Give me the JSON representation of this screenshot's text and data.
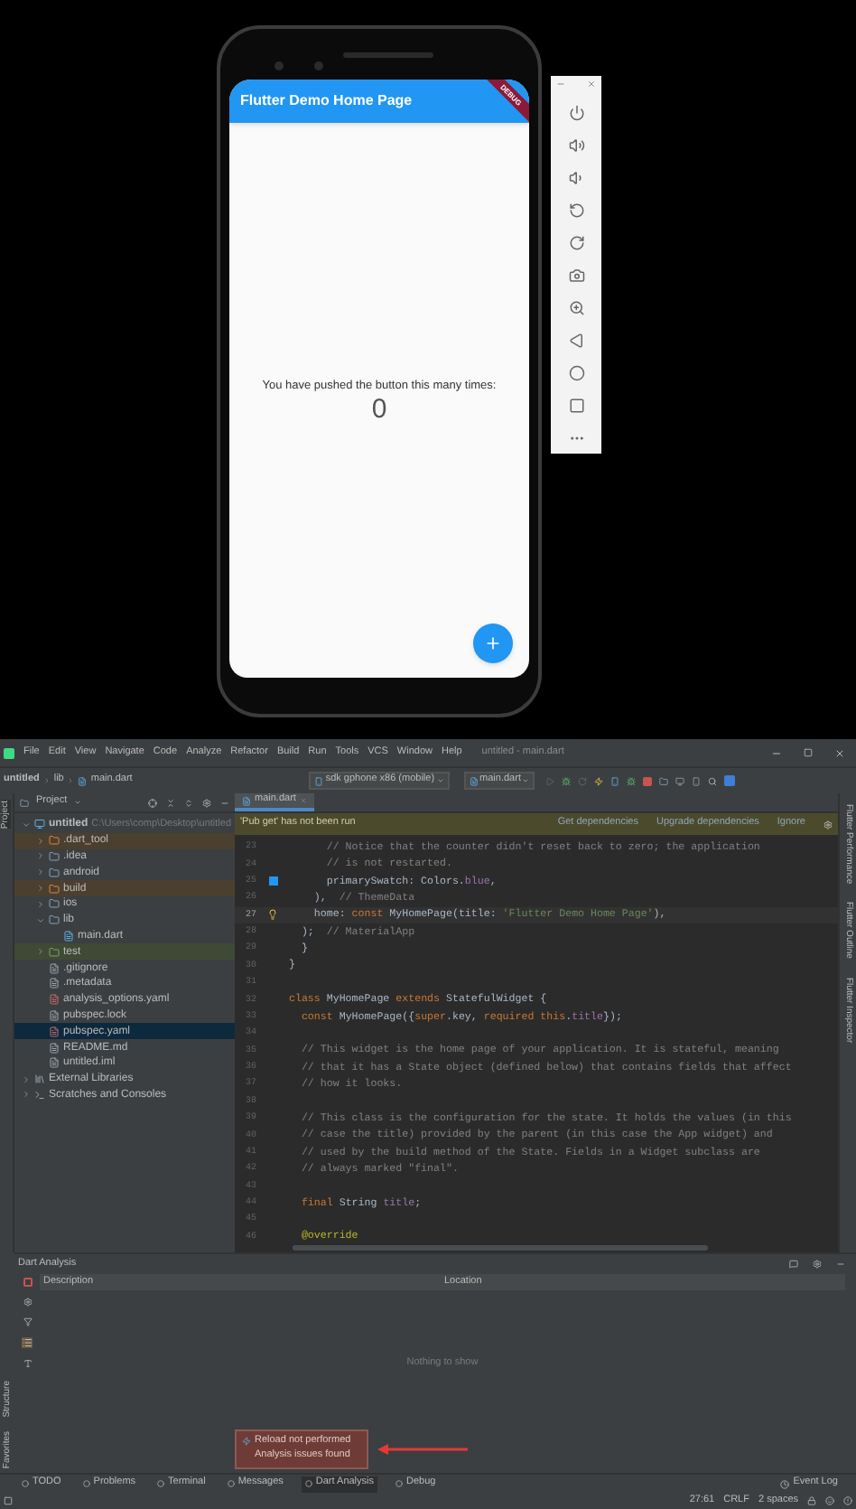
{
  "emulator": {
    "app_title": "Flutter Demo Home Page",
    "debug_banner": "DEBUG",
    "counter_label": "You have pushed the button this many times:",
    "counter_value": "0"
  },
  "menu": [
    "File",
    "Edit",
    "View",
    "Navigate",
    "Code",
    "Analyze",
    "Refactor",
    "Build",
    "Run",
    "Tools",
    "VCS",
    "Window",
    "Help"
  ],
  "window_title": "untitled - main.dart",
  "breadcrumb": [
    "untitled",
    "lib",
    "main.dart"
  ],
  "device_selector": "sdk gphone x86 (mobile)",
  "run_config": "main.dart",
  "left_strip": {
    "top": [
      "Project"
    ],
    "bottom": [
      "Structure",
      "Favorites"
    ]
  },
  "project_panel": {
    "title": "Project",
    "tree": [
      {
        "label": "untitled",
        "path": "C:\\Users\\comp\\Desktop\\untitled",
        "kind": "module",
        "expanded": true,
        "selected": false,
        "children": [
          {
            "label": ".dart_tool",
            "kind": "excluded",
            "expanded": false,
            "selected": false
          },
          {
            "label": ".idea",
            "kind": "folder",
            "expanded": false,
            "selected": false
          },
          {
            "label": "android",
            "kind": "folder",
            "expanded": false,
            "selected": false
          },
          {
            "label": "build",
            "kind": "excluded",
            "expanded": false,
            "selected": false
          },
          {
            "label": "ios",
            "kind": "folder",
            "expanded": false,
            "selected": false
          },
          {
            "label": "lib",
            "kind": "folder",
            "expanded": true,
            "selected": false,
            "children": [
              {
                "label": "main.dart",
                "kind": "dart",
                "selected": false
              }
            ]
          },
          {
            "label": "test",
            "kind": "testfolder",
            "expanded": false,
            "selected": false
          },
          {
            "label": ".gitignore",
            "kind": "file",
            "selected": false
          },
          {
            "label": ".metadata",
            "kind": "file",
            "selected": false
          },
          {
            "label": "analysis_options.yaml",
            "kind": "yaml",
            "selected": false
          },
          {
            "label": "pubspec.lock",
            "kind": "file",
            "selected": false
          },
          {
            "label": "pubspec.yaml",
            "kind": "yaml",
            "selected": true
          },
          {
            "label": "README.md",
            "kind": "file",
            "selected": false
          },
          {
            "label": "untitled.iml",
            "kind": "file",
            "selected": false
          }
        ]
      },
      {
        "label": "External Libraries",
        "kind": "library",
        "expanded": false,
        "selected": false
      },
      {
        "label": "Scratches and Consoles",
        "kind": "scratch",
        "expanded": false,
        "selected": false
      }
    ]
  },
  "editor_tabs": [
    {
      "label": "main.dart",
      "selected": true
    }
  ],
  "notification": {
    "message": "'Pub get' has not been run",
    "actions": [
      "Get dependencies",
      "Upgrade dependencies",
      "Ignore"
    ]
  },
  "code": [
    {
      "number": "23",
      "kind": "plain",
      "current": false,
      "segments": [
        {
          "kind": "comment",
          "text": "      // Notice that the counter didn't reset back to zero; the application"
        }
      ]
    },
    {
      "number": "24",
      "kind": "plain",
      "current": false,
      "segments": [
        {
          "kind": "comment",
          "text": "      // is not restarted."
        }
      ]
    },
    {
      "number": "25",
      "kind": "swatch",
      "current": false,
      "segments": [
        {
          "kind": "plain",
          "text": "      primarySwatch: Colors."
        },
        {
          "kind": "field",
          "text": "blue"
        },
        {
          "kind": "plain",
          "text": ","
        }
      ]
    },
    {
      "number": "26",
      "kind": "plain",
      "current": false,
      "segments": [
        {
          "kind": "plain",
          "text": "    ),  "
        },
        {
          "kind": "comment",
          "text": "// ThemeData"
        }
      ]
    },
    {
      "number": "27",
      "kind": "bulb",
      "current": true,
      "segments": [
        {
          "kind": "plain",
          "text": "    home: "
        },
        {
          "kind": "keyword",
          "text": "const "
        },
        {
          "kind": "plain",
          "text": "MyHomePage(title: "
        },
        {
          "kind": "string",
          "text": "'Flutter Demo Home Page'"
        },
        {
          "kind": "plain",
          "text": "),"
        }
      ]
    },
    {
      "number": "28",
      "kind": "plain",
      "current": false,
      "segments": [
        {
          "kind": "plain",
          "text": "  );  "
        },
        {
          "kind": "comment",
          "text": "// MaterialApp"
        }
      ]
    },
    {
      "number": "29",
      "kind": "plain",
      "current": false,
      "segments": [
        {
          "kind": "plain",
          "text": "  }"
        }
      ]
    },
    {
      "number": "30",
      "kind": "plain",
      "current": false,
      "segments": [
        {
          "kind": "plain",
          "text": "}"
        }
      ]
    },
    {
      "number": "31",
      "kind": "plain",
      "current": false
    },
    {
      "number": "32",
      "kind": "plain",
      "current": false,
      "segments": [
        {
          "kind": "keyword",
          "text": "class "
        },
        {
          "kind": "plain",
          "text": "MyHomePage "
        },
        {
          "kind": "keyword",
          "text": "extends "
        },
        {
          "kind": "plain",
          "text": "StatefulWidget {"
        }
      ]
    },
    {
      "number": "33",
      "kind": "plain",
      "current": false,
      "segments": [
        {
          "kind": "keyword",
          "text": "  const "
        },
        {
          "kind": "plain",
          "text": "MyHomePage({"
        },
        {
          "kind": "keyword",
          "text": "super"
        },
        {
          "kind": "plain",
          "text": ".key, "
        },
        {
          "kind": "keyword",
          "text": "required this"
        },
        {
          "kind": "plain",
          "text": "."
        },
        {
          "kind": "field",
          "text": "title"
        },
        {
          "kind": "plain",
          "text": "});"
        }
      ]
    },
    {
      "number": "34",
      "kind": "plain",
      "current": false
    },
    {
      "number": "35",
      "kind": "plain",
      "current": false,
      "segments": [
        {
          "kind": "comment",
          "text": "  // This widget is the home page of your application. It is stateful, meaning"
        }
      ]
    },
    {
      "number": "36",
      "kind": "plain",
      "current": false,
      "segments": [
        {
          "kind": "comment",
          "text": "  // that it has a State object (defined below) that contains fields that affect"
        }
      ]
    },
    {
      "number": "37",
      "kind": "plain",
      "current": false,
      "segments": [
        {
          "kind": "comment",
          "text": "  // how it looks."
        }
      ]
    },
    {
      "number": "38",
      "kind": "plain",
      "current": false
    },
    {
      "number": "39",
      "kind": "plain",
      "current": false,
      "segments": [
        {
          "kind": "comment",
          "text": "  // This class is the configuration for the state. It holds the values (in this"
        }
      ]
    },
    {
      "number": "40",
      "kind": "plain",
      "current": false,
      "segments": [
        {
          "kind": "comment",
          "text": "  // case the title) provided by the parent (in this case the App widget) and"
        }
      ]
    },
    {
      "number": "41",
      "kind": "plain",
      "current": false,
      "segments": [
        {
          "kind": "comment",
          "text": "  // used by the build method of the State. Fields in a Widget subclass are"
        }
      ]
    },
    {
      "number": "42",
      "kind": "plain",
      "current": false,
      "segments": [
        {
          "kind": "comment",
          "text": "  // always marked \"final\"."
        }
      ]
    },
    {
      "number": "43",
      "kind": "plain",
      "current": false
    },
    {
      "number": "44",
      "kind": "plain",
      "current": false,
      "segments": [
        {
          "kind": "keyword",
          "text": "  final "
        },
        {
          "kind": "plain",
          "text": "String "
        },
        {
          "kind": "field",
          "text": "title"
        },
        {
          "kind": "plain",
          "text": ";"
        }
      ]
    },
    {
      "number": "45",
      "kind": "plain",
      "current": false
    },
    {
      "number": "46",
      "kind": "plain",
      "current": false,
      "segments": [
        {
          "kind": "annotation",
          "text": "  @override"
        }
      ]
    }
  ],
  "right_strip": [
    "Flutter Performance",
    "Flutter Outline",
    "Flutter Inspector"
  ],
  "analysis": {
    "title": "Dart Analysis",
    "columns": [
      "Description",
      "Location"
    ],
    "empty_text": "Nothing to show"
  },
  "popup": {
    "lines": [
      "Reload not performed",
      "Analysis issues found"
    ]
  },
  "tool_windows": [
    {
      "label": "TODO",
      "selected": false
    },
    {
      "label": "Problems",
      "selected": false
    },
    {
      "label": "Terminal",
      "selected": false
    },
    {
      "label": "Messages",
      "selected": false
    },
    {
      "label": "Dart Analysis",
      "selected": true
    },
    {
      "label": "Debug",
      "selected": false
    }
  ],
  "event_log": "Event Log",
  "status": [
    "27:61",
    "CRLF",
    "2 spaces"
  ]
}
